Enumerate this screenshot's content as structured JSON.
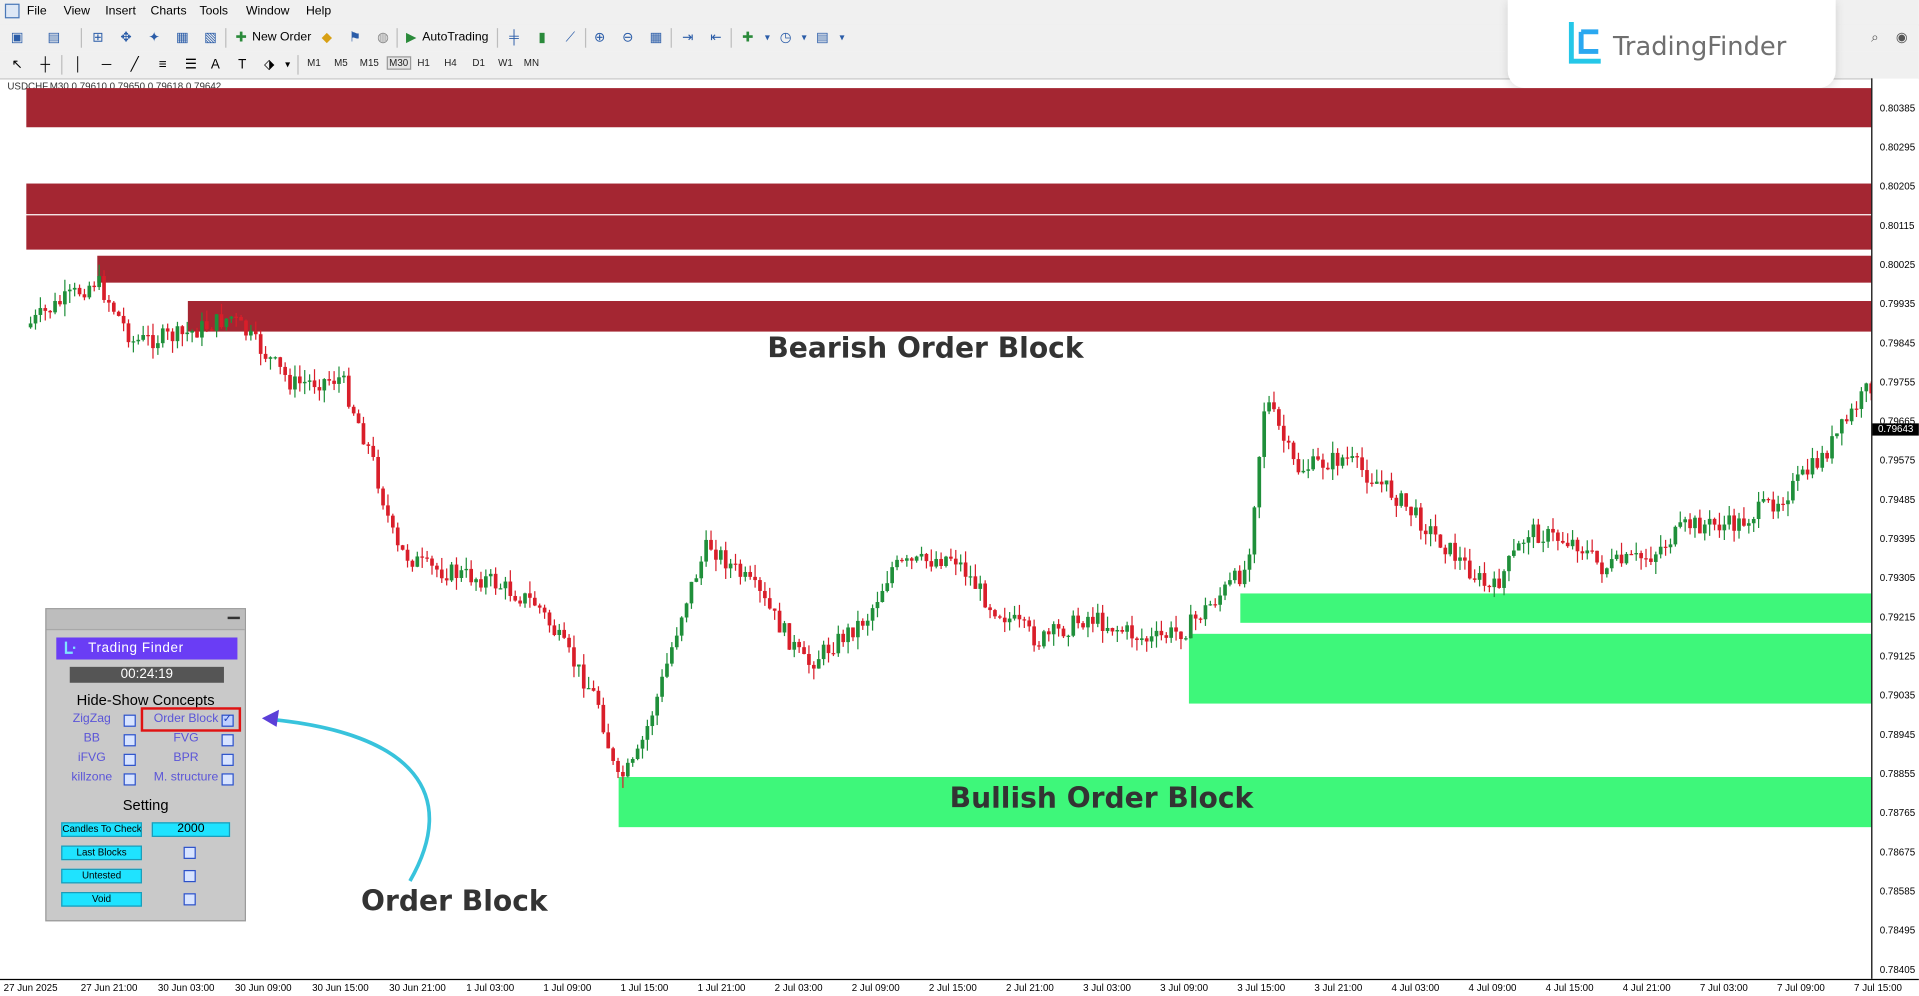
{
  "menu": [
    "File",
    "Insert",
    "Charts",
    "Tools",
    "Window",
    "Help"
  ],
  "view_label": "View",
  "toolbar": {
    "new_order": "New Order",
    "autotrading": "AutoTrading",
    "timeframes": [
      "M1",
      "M5",
      "M15",
      "M30",
      "H1",
      "H4",
      "D1",
      "W1",
      "MN"
    ]
  },
  "logo": {
    "text": "TradingFinder"
  },
  "chart": {
    "symbol_info": "USDCHF,M30  0.79610 0.79650 0.79618 0.79642",
    "current_price": "0.79643",
    "y_labels": [
      "0.80385",
      "0.80295",
      "0.80205",
      "0.80115",
      "0.80025",
      "0.79935",
      "0.79845",
      "0.79755",
      "0.79665",
      "0.79575",
      "0.79485",
      "0.79395",
      "0.79305",
      "0.79215",
      "0.79125",
      "0.79035",
      "0.78945",
      "0.78855",
      "0.78765",
      "0.78675",
      "0.78585",
      "0.78495",
      "0.78405"
    ],
    "x_labels": [
      "27 Jun 2025",
      "27 Jun 21:00",
      "30 Jun 03:00",
      "30 Jun 09:00",
      "30 Jun 15:00",
      "30 Jun 21:00",
      "1 Jul 03:00",
      "1 Jul 09:00",
      "1 Jul 15:00",
      "1 Jul 21:00",
      "2 Jul 03:00",
      "2 Jul 09:00",
      "2 Jul 15:00",
      "2 Jul 21:00",
      "3 Jul 03:00",
      "3 Jul 09:00",
      "3 Jul 15:00",
      "3 Jul 21:00",
      "4 Jul 03:00",
      "4 Jul 09:00",
      "4 Jul 15:00",
      "4 Jul 21:00",
      "7 Jul 03:00",
      "7 Jul 09:00",
      "7 Jul 15:00"
    ],
    "bearish_color": "#a42632",
    "bullish_color": "#3ef77a",
    "up_candle_color": "#1f8f3a",
    "down_candle_color": "#d91e2a"
  },
  "annotations": {
    "bearish": "Bearish Order Block",
    "bullish": "Bullish Order Block",
    "order_block": "Order Block"
  },
  "panel": {
    "brand": "Trading Finder",
    "timer": "00:24:19",
    "concepts_title": "Hide-Show Concepts",
    "concepts": [
      {
        "label": "ZigZag",
        "checked": false
      },
      {
        "label": "Order Block",
        "checked": true
      },
      {
        "label": "BB",
        "checked": false
      },
      {
        "label": "FVG",
        "checked": false
      },
      {
        "label": "iFVG",
        "checked": false
      },
      {
        "label": "BPR",
        "checked": false
      },
      {
        "label": "killzone",
        "checked": false
      },
      {
        "label": "M. structure",
        "checked": false
      }
    ],
    "setting_title": "Setting",
    "candles_label": "Candles To Check",
    "candles_value": "2000",
    "options": [
      "Last Blocks",
      "Untested",
      "Void"
    ]
  }
}
